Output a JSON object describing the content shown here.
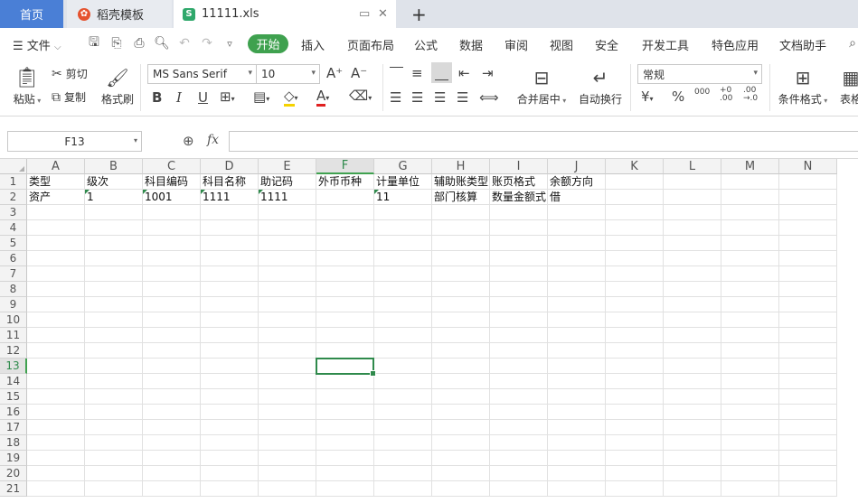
{
  "tabs": {
    "home": "首页",
    "templates": "稻壳模板",
    "file": "11111.xls",
    "new_tab": "+"
  },
  "menu": {
    "file": "文件",
    "items": [
      "开始",
      "插入",
      "页面布局",
      "公式",
      "数据",
      "审阅",
      "视图",
      "安全",
      "开发工具",
      "特色应用",
      "文档助手"
    ]
  },
  "ribbon": {
    "paste": "粘贴",
    "cut": "剪切",
    "copy": "复制",
    "format_painter": "格式刷",
    "font_name": "MS Sans Serif",
    "font_size": "10",
    "font_grow": "A⁺",
    "font_shrink": "A⁻",
    "bold": "B",
    "italic": "I",
    "underline": "U",
    "font_color_letter": "A",
    "merge_center": "合并居中",
    "wrap_text": "自动换行",
    "number_format": "常规",
    "percent": "%",
    "thousands": "000",
    "inc_decimal": "+0\n.00",
    "dec_decimal": ".00\n→.0",
    "conditional_format": "条件格式",
    "table_style": "表格"
  },
  "formula_bar": {
    "name_box": "F13",
    "fx": "fx",
    "value": ""
  },
  "sheet": {
    "columns": [
      "A",
      "B",
      "C",
      "D",
      "E",
      "F",
      "G",
      "H",
      "I",
      "J",
      "K",
      "L",
      "M",
      "N"
    ],
    "rows": [
      "1",
      "2",
      "3",
      "4",
      "5",
      "6",
      "7",
      "8",
      "9",
      "10",
      "11",
      "12",
      "13",
      "14",
      "15",
      "16",
      "17",
      "18",
      "19",
      "20",
      "21"
    ],
    "active_cell": "F13",
    "row1": [
      "类型",
      "级次",
      "科目编码",
      "科目名称",
      "助记码",
      "外币币种",
      "计量单位",
      "辅助账类型",
      "账页格式",
      "余额方向"
    ],
    "row2": [
      "资产",
      "1",
      "1001",
      "1111",
      "1111",
      "",
      "11",
      "部门核算",
      "数量金额式",
      "借"
    ]
  },
  "colors": {
    "accent_green": "#3fa14f",
    "home_tab_blue": "#4a7fd6"
  }
}
